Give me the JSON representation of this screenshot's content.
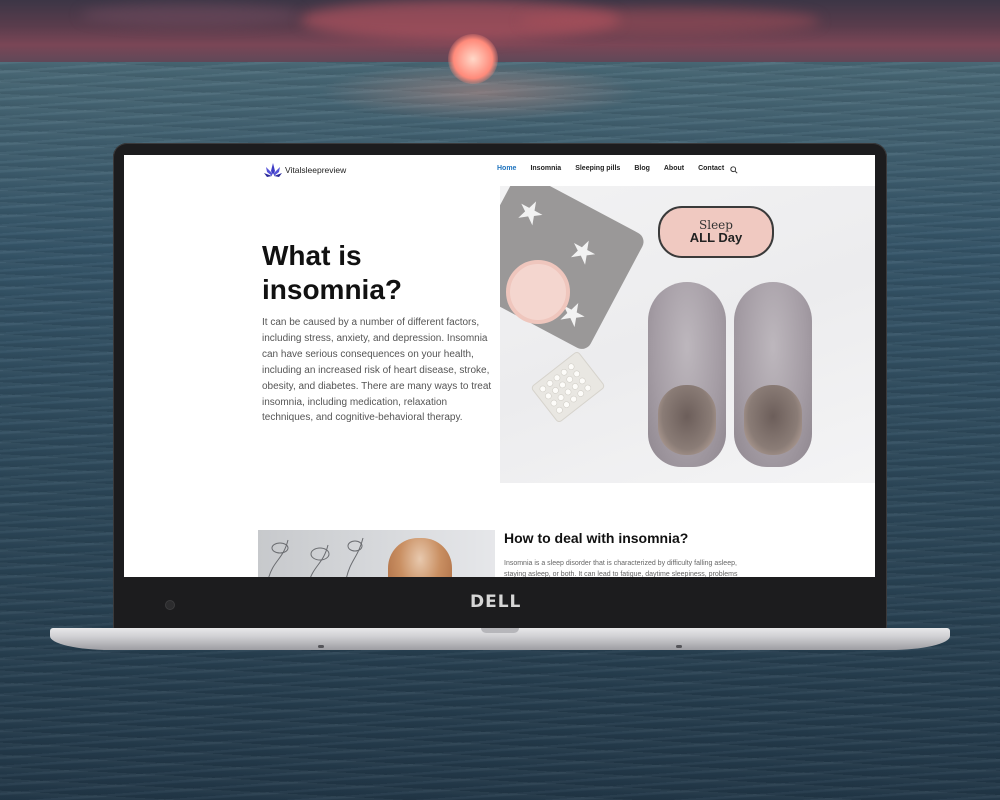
{
  "site": {
    "logo_text": "Vitalsleepreview",
    "menu": [
      {
        "label": "Home",
        "active": true
      },
      {
        "label": "Insomnia",
        "active": false
      },
      {
        "label": "Sleeping pills",
        "active": false
      },
      {
        "label": "Blog",
        "active": false
      },
      {
        "label": "About",
        "active": false
      },
      {
        "label": "Contact",
        "active": false
      }
    ],
    "accent_color": "#1e73be"
  },
  "hero": {
    "title": "What is insomnia?",
    "text": "It can be caused by a number of different factors, including stress, anxiety, and depression. Insomnia can have serious consequences on your health, including an increased risk of heart disease, stroke, obesity, and diabetes. There are many ways to treat insomnia, including medication, relaxation techniques, and cognitive-behavioral therapy.",
    "mask_line1": "Sleep",
    "mask_line2": "ALL Day"
  },
  "section": {
    "title": "How to deal with insomnia?",
    "text": "Insomnia is a sleep disorder that is characterized by difficulty falling asleep, staying asleep, or both. It can lead to fatigue, daytime sleepiness, problems"
  },
  "laptop": {
    "brand": "DELL"
  }
}
